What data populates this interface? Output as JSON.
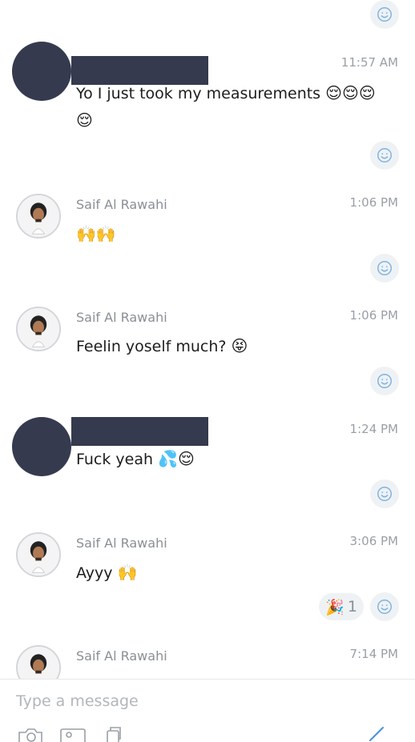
{
  "messages": [
    {
      "sender": "",
      "time": "11:57 AM",
      "text": "Yo I just took my measurements",
      "emoji": "😌😌😌 😌",
      "avatar": "redacted"
    },
    {
      "sender": "Saif Al Rawahi",
      "time": "1:06 PM",
      "text": "",
      "emoji": "🙌🙌",
      "avatar": "photo"
    },
    {
      "sender": "Saif Al Rawahi",
      "time": "1:06 PM",
      "text": "Feelin yoself much?",
      "emoji": "😝",
      "avatar": "photo"
    },
    {
      "sender": "",
      "time": "1:24 PM",
      "text": "Fuck yeah",
      "emoji": "💦😌",
      "avatar": "redacted"
    },
    {
      "sender": "Saif Al Rawahi",
      "time": "3:06 PM",
      "text": "Ayyy",
      "emoji": "🙌",
      "avatar": "photo",
      "reaction": {
        "emoji": "🎉",
        "count": "1"
      }
    },
    {
      "sender": "Saif Al Rawahi",
      "time": "7:14 PM",
      "text": "",
      "emoji": "",
      "avatar": "photo"
    }
  ],
  "composer": {
    "placeholder": "Type a message"
  },
  "icons": {
    "react": "smiley-face-icon",
    "camera": "camera-icon",
    "photo": "photo-icon",
    "gif": "gif-icon",
    "send": "send-icon"
  },
  "colors": {
    "redaction": "#353a4f",
    "icon_blue": "#7fb3e0",
    "reaction_bg": "#eef2f5"
  }
}
